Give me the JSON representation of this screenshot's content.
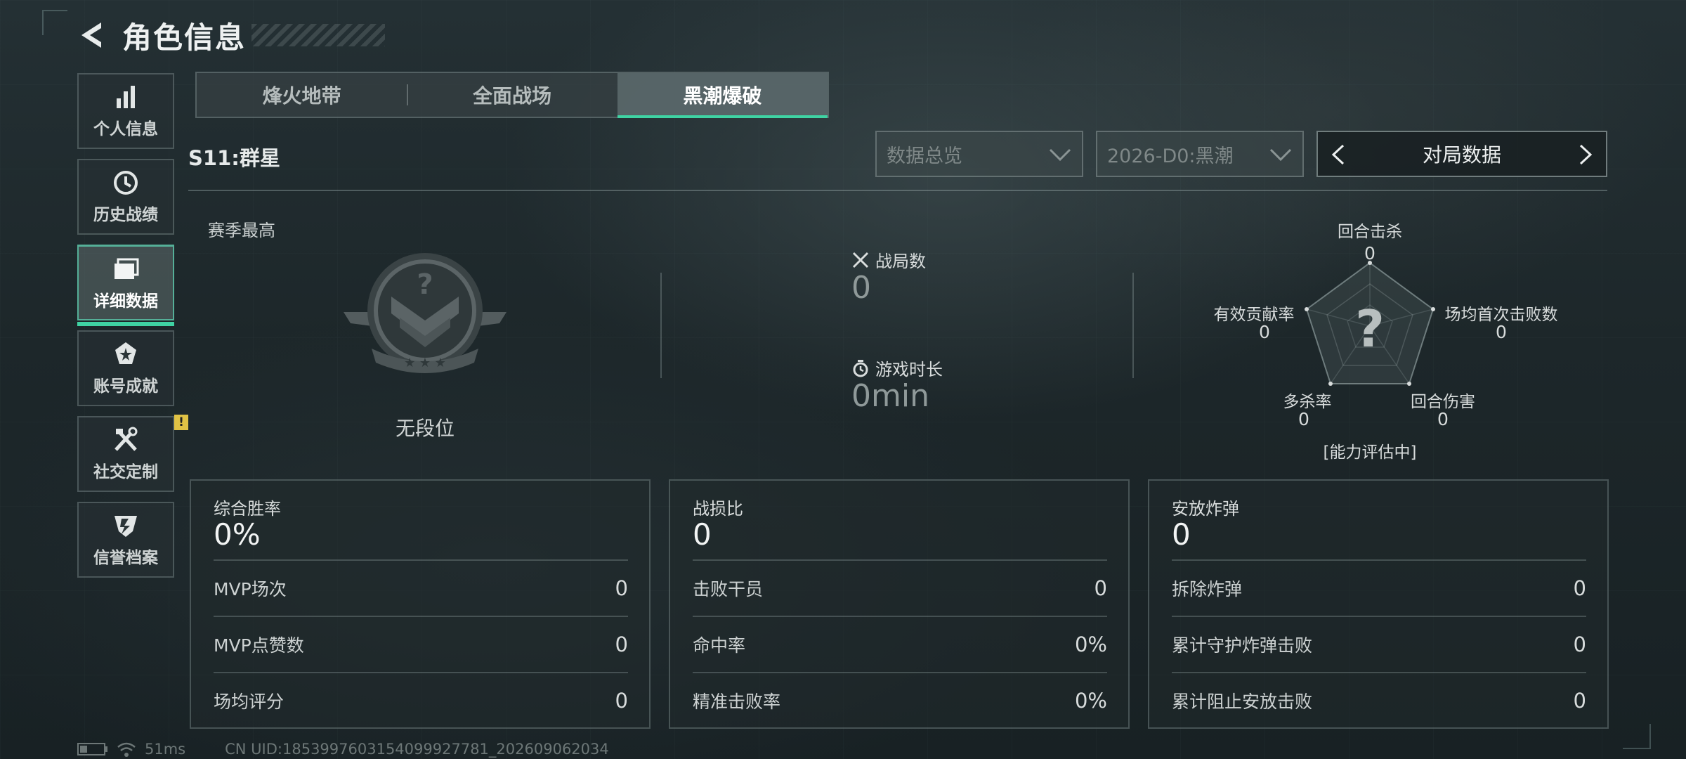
{
  "header": {
    "title": "角色信息"
  },
  "sidebar": {
    "items": [
      {
        "label": "个人信息",
        "icon": "bar-chart-icon"
      },
      {
        "label": "历史战绩",
        "icon": "history-clock-icon"
      },
      {
        "label": "详细数据",
        "icon": "folder-icon",
        "active": true
      },
      {
        "label": "账号成就",
        "icon": "achievement-badge-icon"
      },
      {
        "label": "社交定制",
        "icon": "tools-icon",
        "badge": "!"
      },
      {
        "label": "信誉档案",
        "icon": "credit-shield-icon"
      }
    ]
  },
  "tabs": [
    {
      "label": "烽火地带"
    },
    {
      "label": "全面战场"
    },
    {
      "label": "黑潮爆破",
      "active": true
    }
  ],
  "season": {
    "label": "S11:群星"
  },
  "filters": {
    "data_overview": "数据总览",
    "season_mode": "2026-D0:黑潮",
    "pager_label": "对局数据"
  },
  "summary": {
    "season_best_label": "赛季最高",
    "rank_label": "无段位",
    "matches_label": "战局数",
    "matches_value": "0",
    "playtime_label": "游戏时长",
    "playtime_value": "0min"
  },
  "radar": {
    "axes": [
      {
        "label": "回合击杀",
        "value": "0"
      },
      {
        "label": "场均首次击败数",
        "value": "0"
      },
      {
        "label": "回合伤害",
        "value": "0"
      },
      {
        "label": "多杀率",
        "value": "0"
      },
      {
        "label": "有效贡献率",
        "value": "0"
      }
    ],
    "status": "[能力评估中]",
    "center_mark": "?"
  },
  "cards": [
    {
      "title": "综合胜率",
      "value": "0%",
      "rows": [
        {
          "label": "MVP场次",
          "value": "0"
        },
        {
          "label": "MVP点赞数",
          "value": "0"
        },
        {
          "label": "场均评分",
          "value": "0"
        }
      ]
    },
    {
      "title": "战损比",
      "value": "0",
      "rows": [
        {
          "label": "击败干员",
          "value": "0"
        },
        {
          "label": "命中率",
          "value": "0%"
        },
        {
          "label": "精准击败率",
          "value": "0%"
        }
      ]
    },
    {
      "title": "安放炸弹",
      "value": "0",
      "rows": [
        {
          "label": "拆除炸弹",
          "value": "0"
        },
        {
          "label": "累计守护炸弹击败",
          "value": "0"
        },
        {
          "label": "累计阻止安放击败",
          "value": "0"
        }
      ]
    }
  ],
  "footer": {
    "ping": "51ms",
    "uid": "CN UID:1853997603154099927781_202609062034"
  },
  "colors": {
    "accent": "#3fd3a3",
    "badge": "#e0c245",
    "background": "#1c2528"
  }
}
